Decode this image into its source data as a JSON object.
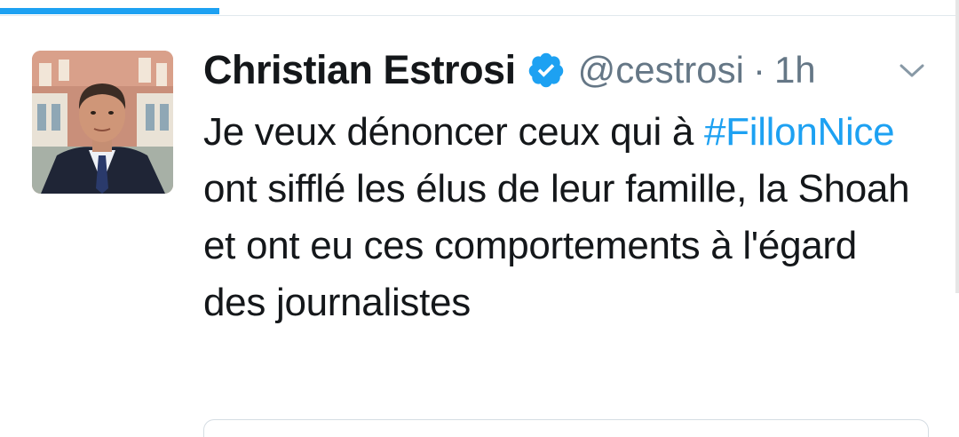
{
  "progress": {
    "fraction": 0.229,
    "color": "#1da1f2"
  },
  "tweet": {
    "author_name": "Christian Estrosi",
    "verified": true,
    "handle": "@cestrosi",
    "separator": "·",
    "time": "1h",
    "text_before": "Je veux dénoncer ceux qui à ",
    "hashtag": "#FillonNice",
    "text_after": " ont sifflé les élus de leur famille, la Shoah et ont eu ces comportements à l'égard des journalistes",
    "hashtag_color": "#1da1f2"
  },
  "icons": {
    "verified": "verified-badge-icon",
    "menu": "chevron-down-icon"
  }
}
